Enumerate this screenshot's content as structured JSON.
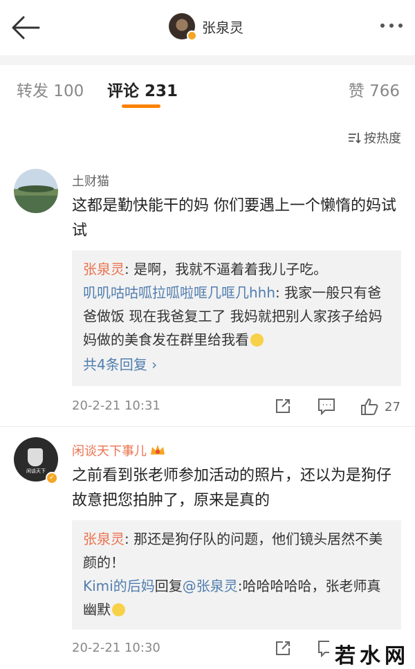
{
  "header": {
    "author_name": "张泉灵"
  },
  "tabs": [
    {
      "label": "转发 100"
    },
    {
      "label": "评论 231"
    },
    {
      "label": "赞 766"
    }
  ],
  "sort_label": "按热度",
  "comments": [
    {
      "username": "土财猫",
      "text": "这都是勤快能干的妈 你们要遇上一个懒惰的妈试试",
      "replies": [
        {
          "name": "张泉灵",
          "text": ": 是啊，我就不逼着着我儿子吃。"
        },
        {
          "name": "叽叽咕咕呱拉呱啦哐几哐几hhh",
          "text": ": 我家一般只有爸爸做饭 现在我爸复工了 我妈就把别人家孩子给妈妈做的美食发在群里给我看"
        }
      ],
      "more_replies": "共4条回复 ›",
      "time": "20-2-21 10:31",
      "likes": "27"
    },
    {
      "username": "闲谈天下事儿",
      "avatar_caption": "闲谈天下",
      "text": "之前看到张老师参加活动的照片，还以为是狗仔故意把您拍肿了，原来是真的",
      "replies": [
        {
          "name": "张泉灵",
          "text": ": 那还是狗仔队的问题，他们镜头居然不美颜的！"
        },
        {
          "name": "Kimi的后妈",
          "mid": "回复",
          "target": "@张泉灵",
          "text": ":哈哈哈哈哈，张老师真幽默"
        }
      ],
      "time": "20-2-21 10:30"
    }
  ],
  "watermark": "若水网",
  "colors": {
    "accent": "#ff8200",
    "link": "#507daf",
    "name_orange": "#eb7350"
  },
  "icons": [
    "back-arrow-icon",
    "more-dots-icon",
    "verified-badge-icon",
    "sort-icon",
    "share-icon",
    "comment-icon",
    "like-icon",
    "crown-icon",
    "emoji-icon"
  ]
}
